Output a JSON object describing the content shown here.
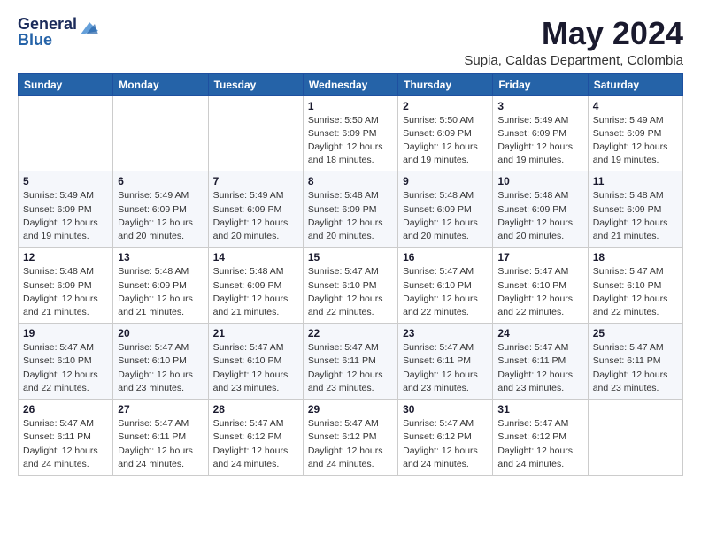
{
  "logo": {
    "line1": "General",
    "line2": "Blue"
  },
  "title": {
    "month_year": "May 2024",
    "location": "Supia, Caldas Department, Colombia"
  },
  "weekdays": [
    "Sunday",
    "Monday",
    "Tuesday",
    "Wednesday",
    "Thursday",
    "Friday",
    "Saturday"
  ],
  "weeks": [
    [
      {
        "day": "",
        "info": ""
      },
      {
        "day": "",
        "info": ""
      },
      {
        "day": "",
        "info": ""
      },
      {
        "day": "1",
        "info": "Sunrise: 5:50 AM\nSunset: 6:09 PM\nDaylight: 12 hours\nand 18 minutes."
      },
      {
        "day": "2",
        "info": "Sunrise: 5:50 AM\nSunset: 6:09 PM\nDaylight: 12 hours\nand 19 minutes."
      },
      {
        "day": "3",
        "info": "Sunrise: 5:49 AM\nSunset: 6:09 PM\nDaylight: 12 hours\nand 19 minutes."
      },
      {
        "day": "4",
        "info": "Sunrise: 5:49 AM\nSunset: 6:09 PM\nDaylight: 12 hours\nand 19 minutes."
      }
    ],
    [
      {
        "day": "5",
        "info": "Sunrise: 5:49 AM\nSunset: 6:09 PM\nDaylight: 12 hours\nand 19 minutes."
      },
      {
        "day": "6",
        "info": "Sunrise: 5:49 AM\nSunset: 6:09 PM\nDaylight: 12 hours\nand 20 minutes."
      },
      {
        "day": "7",
        "info": "Sunrise: 5:49 AM\nSunset: 6:09 PM\nDaylight: 12 hours\nand 20 minutes."
      },
      {
        "day": "8",
        "info": "Sunrise: 5:48 AM\nSunset: 6:09 PM\nDaylight: 12 hours\nand 20 minutes."
      },
      {
        "day": "9",
        "info": "Sunrise: 5:48 AM\nSunset: 6:09 PM\nDaylight: 12 hours\nand 20 minutes."
      },
      {
        "day": "10",
        "info": "Sunrise: 5:48 AM\nSunset: 6:09 PM\nDaylight: 12 hours\nand 20 minutes."
      },
      {
        "day": "11",
        "info": "Sunrise: 5:48 AM\nSunset: 6:09 PM\nDaylight: 12 hours\nand 21 minutes."
      }
    ],
    [
      {
        "day": "12",
        "info": "Sunrise: 5:48 AM\nSunset: 6:09 PM\nDaylight: 12 hours\nand 21 minutes."
      },
      {
        "day": "13",
        "info": "Sunrise: 5:48 AM\nSunset: 6:09 PM\nDaylight: 12 hours\nand 21 minutes."
      },
      {
        "day": "14",
        "info": "Sunrise: 5:48 AM\nSunset: 6:09 PM\nDaylight: 12 hours\nand 21 minutes."
      },
      {
        "day": "15",
        "info": "Sunrise: 5:47 AM\nSunset: 6:10 PM\nDaylight: 12 hours\nand 22 minutes."
      },
      {
        "day": "16",
        "info": "Sunrise: 5:47 AM\nSunset: 6:10 PM\nDaylight: 12 hours\nand 22 minutes."
      },
      {
        "day": "17",
        "info": "Sunrise: 5:47 AM\nSunset: 6:10 PM\nDaylight: 12 hours\nand 22 minutes."
      },
      {
        "day": "18",
        "info": "Sunrise: 5:47 AM\nSunset: 6:10 PM\nDaylight: 12 hours\nand 22 minutes."
      }
    ],
    [
      {
        "day": "19",
        "info": "Sunrise: 5:47 AM\nSunset: 6:10 PM\nDaylight: 12 hours\nand 22 minutes."
      },
      {
        "day": "20",
        "info": "Sunrise: 5:47 AM\nSunset: 6:10 PM\nDaylight: 12 hours\nand 23 minutes."
      },
      {
        "day": "21",
        "info": "Sunrise: 5:47 AM\nSunset: 6:10 PM\nDaylight: 12 hours\nand 23 minutes."
      },
      {
        "day": "22",
        "info": "Sunrise: 5:47 AM\nSunset: 6:11 PM\nDaylight: 12 hours\nand 23 minutes."
      },
      {
        "day": "23",
        "info": "Sunrise: 5:47 AM\nSunset: 6:11 PM\nDaylight: 12 hours\nand 23 minutes."
      },
      {
        "day": "24",
        "info": "Sunrise: 5:47 AM\nSunset: 6:11 PM\nDaylight: 12 hours\nand 23 minutes."
      },
      {
        "day": "25",
        "info": "Sunrise: 5:47 AM\nSunset: 6:11 PM\nDaylight: 12 hours\nand 23 minutes."
      }
    ],
    [
      {
        "day": "26",
        "info": "Sunrise: 5:47 AM\nSunset: 6:11 PM\nDaylight: 12 hours\nand 24 minutes."
      },
      {
        "day": "27",
        "info": "Sunrise: 5:47 AM\nSunset: 6:11 PM\nDaylight: 12 hours\nand 24 minutes."
      },
      {
        "day": "28",
        "info": "Sunrise: 5:47 AM\nSunset: 6:12 PM\nDaylight: 12 hours\nand 24 minutes."
      },
      {
        "day": "29",
        "info": "Sunrise: 5:47 AM\nSunset: 6:12 PM\nDaylight: 12 hours\nand 24 minutes."
      },
      {
        "day": "30",
        "info": "Sunrise: 5:47 AM\nSunset: 6:12 PM\nDaylight: 12 hours\nand 24 minutes."
      },
      {
        "day": "31",
        "info": "Sunrise: 5:47 AM\nSunset: 6:12 PM\nDaylight: 12 hours\nand 24 minutes."
      },
      {
        "day": "",
        "info": ""
      }
    ]
  ]
}
